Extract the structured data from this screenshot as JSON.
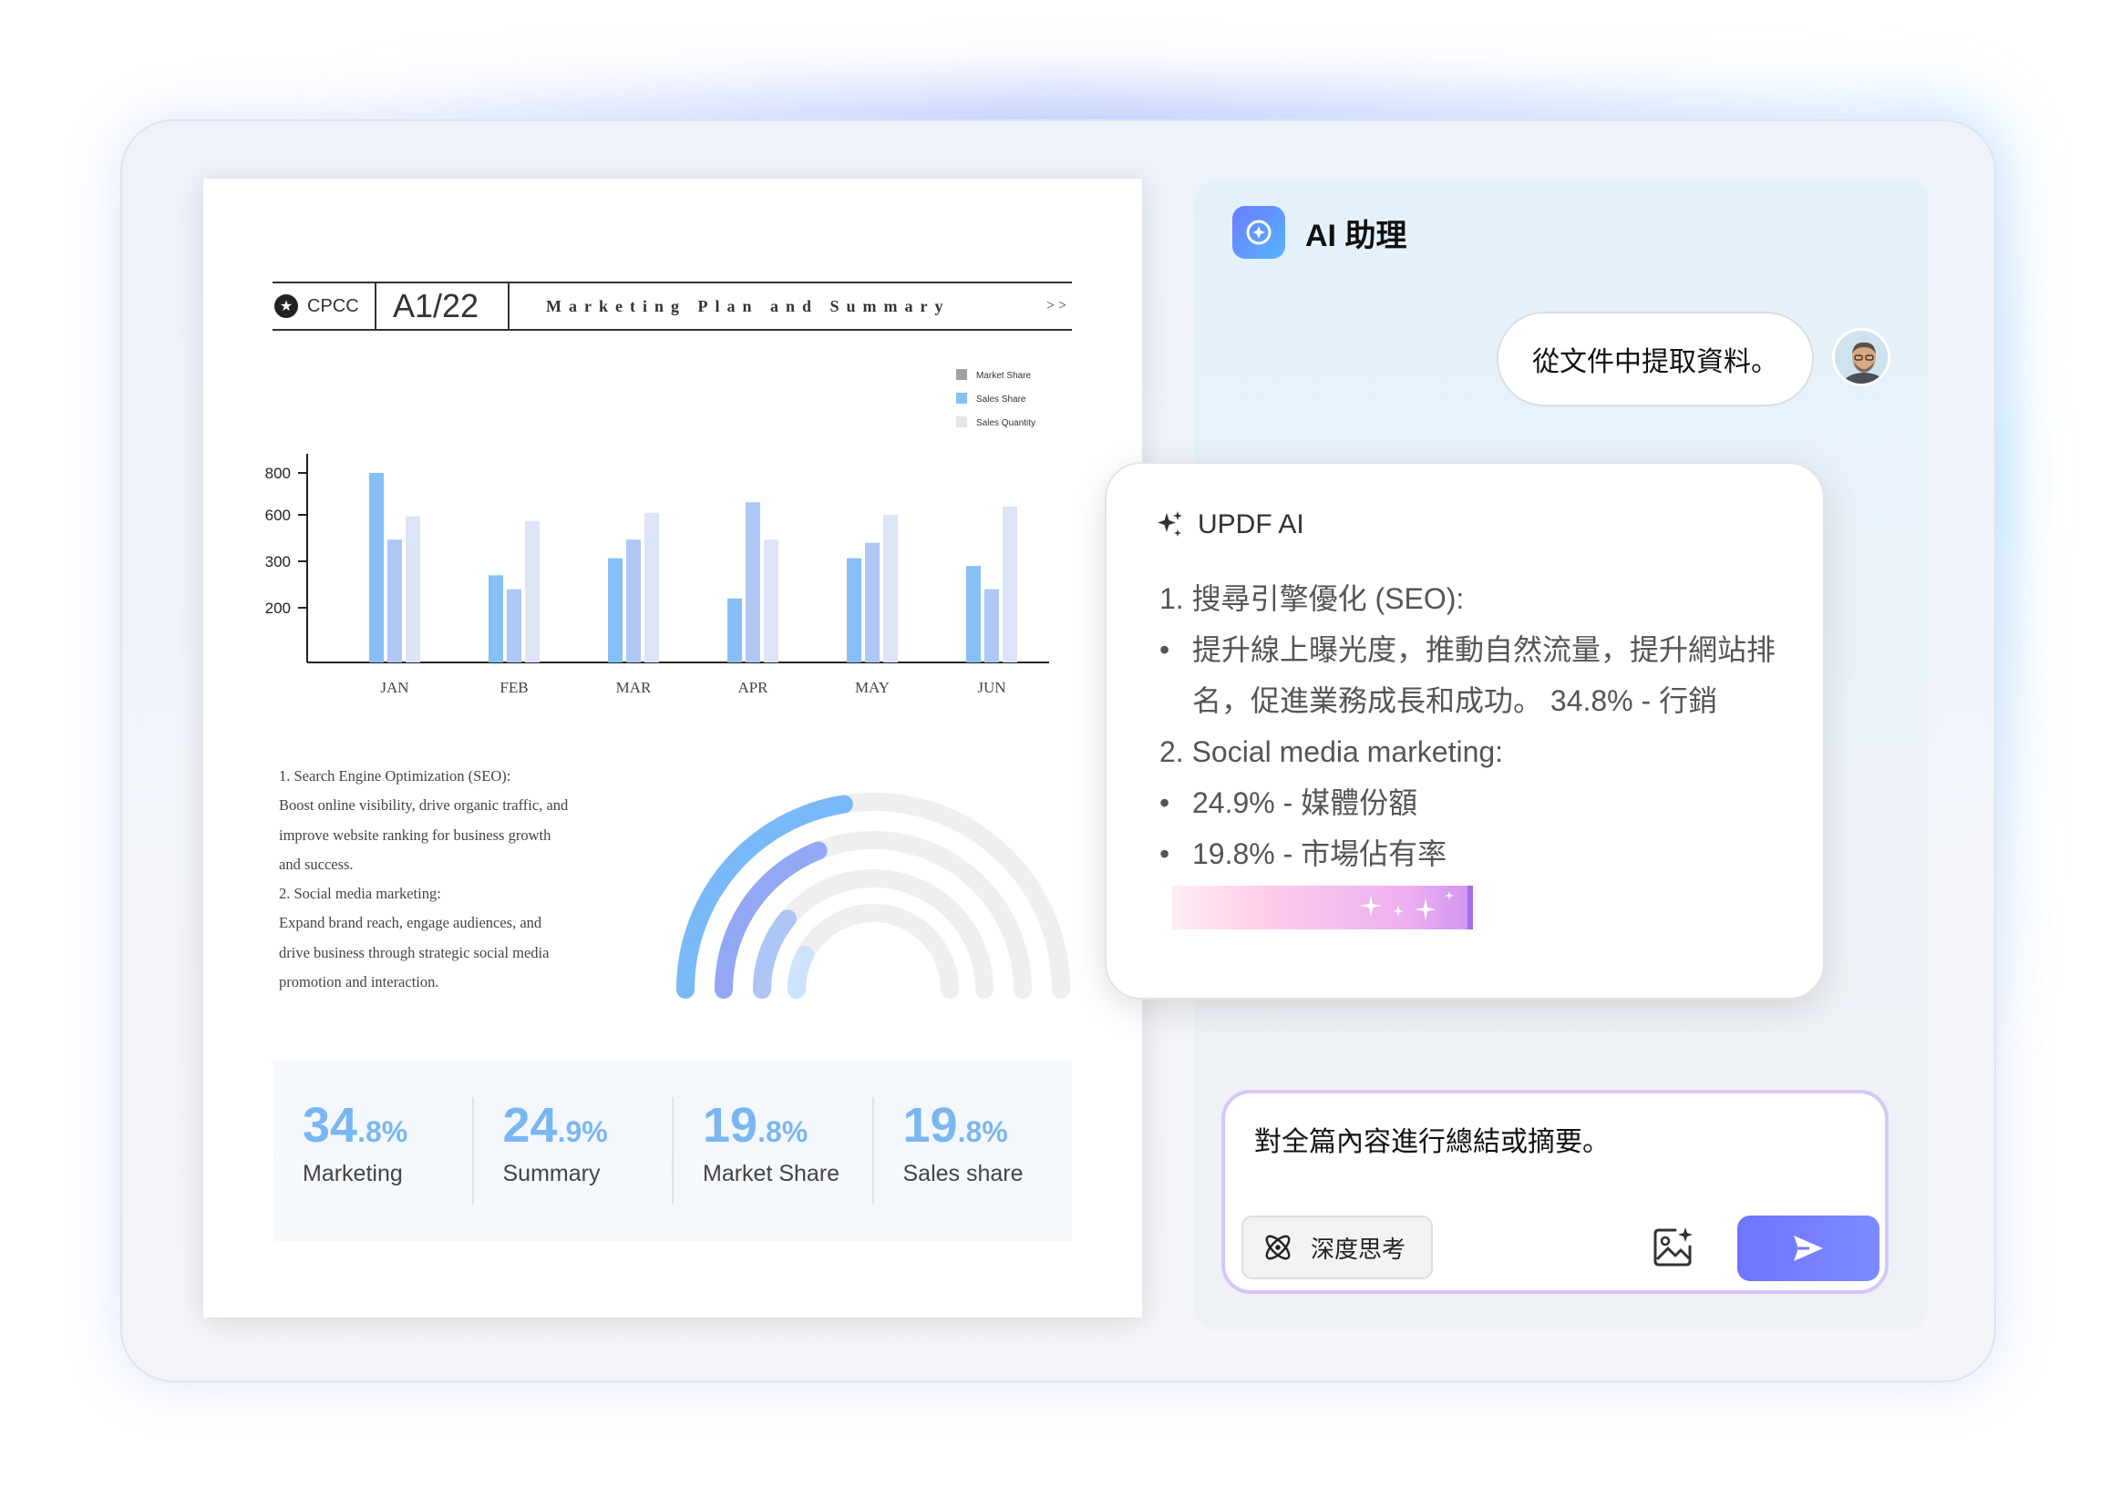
{
  "document": {
    "brand": "CPCC",
    "page_number": "A1/22",
    "title": "Marketing Plan and Summary",
    "next": ">>",
    "notes": [
      "1. Search Engine Optimization (SEO):",
      "Boost online visibility, drive organic traffic, and",
      "improve website ranking for business growth",
      "and success.",
      "2. Social media marketing:",
      "Expand brand reach, engage audiences, and",
      "drive business through strategic social media",
      "promotion and interaction."
    ],
    "stats": [
      {
        "big": "34",
        "small": ".8%",
        "label": "Marketing"
      },
      {
        "big": "24",
        "small": ".9%",
        "label": "Summary"
      },
      {
        "big": "19",
        "small": ".8%",
        "label": "Market Share"
      },
      {
        "big": "19",
        "small": ".8%",
        "label": "Sales share"
      }
    ]
  },
  "chart_data": {
    "type": "bar",
    "categories": [
      "JAN",
      "FEB",
      "MAR",
      "APR",
      "MAY",
      "JUN"
    ],
    "y_ticks": [
      "800",
      "600",
      "300",
      "200"
    ],
    "series": [
      {
        "name": "Market Share",
        "values": [
          800,
          270,
          320,
          220,
          320,
          290
        ],
        "color": "#86c0f7"
      },
      {
        "name": "Sales Share",
        "values": [
          440,
          240,
          440,
          660,
          420,
          240
        ],
        "color": "#aec8f5"
      },
      {
        "name": "Sales Quantity",
        "values": [
          590,
          560,
          610,
          440,
          600,
          640
        ],
        "color": "#dde4f7"
      }
    ],
    "legend": [
      {
        "name": "Market Share",
        "color": "#a1a1a1"
      },
      {
        "name": "Sales Share",
        "color": "#86c0f7"
      },
      {
        "name": "Sales Quantity",
        "color": "#e6e6e6"
      }
    ],
    "legend_position": "top-right",
    "grid": false
  },
  "rings_chart": {
    "type": "radial-bar",
    "values": [
      0.45,
      0.38,
      0.22,
      0.15
    ],
    "colors": [
      "#7ab9f8",
      "#93a8f4",
      "#adc6f6",
      "#cde3fb"
    ],
    "track_color": "#efefef"
  },
  "assistant": {
    "title": "AI 助理",
    "user_message": "從文件中提取資料。",
    "ai_name": "UPDF AI",
    "response": {
      "h1": "1. 搜尋引擎優化 (SEO):",
      "b1a": "提升線上曝光度，推動自然流量，提升網站排",
      "b1b": "名，促進業務成長和成功。 34.8% - 行銷",
      "h2": "2. Social media marketing:",
      "b2": "24.9% - 媒體份額",
      "b3": "19.8% - 市場佔有率"
    },
    "input_value": "對全篇內容進行總結或摘要。",
    "deep_think_label": "深度思考",
    "bullet": "•",
    "accent": "#6f74ff"
  }
}
